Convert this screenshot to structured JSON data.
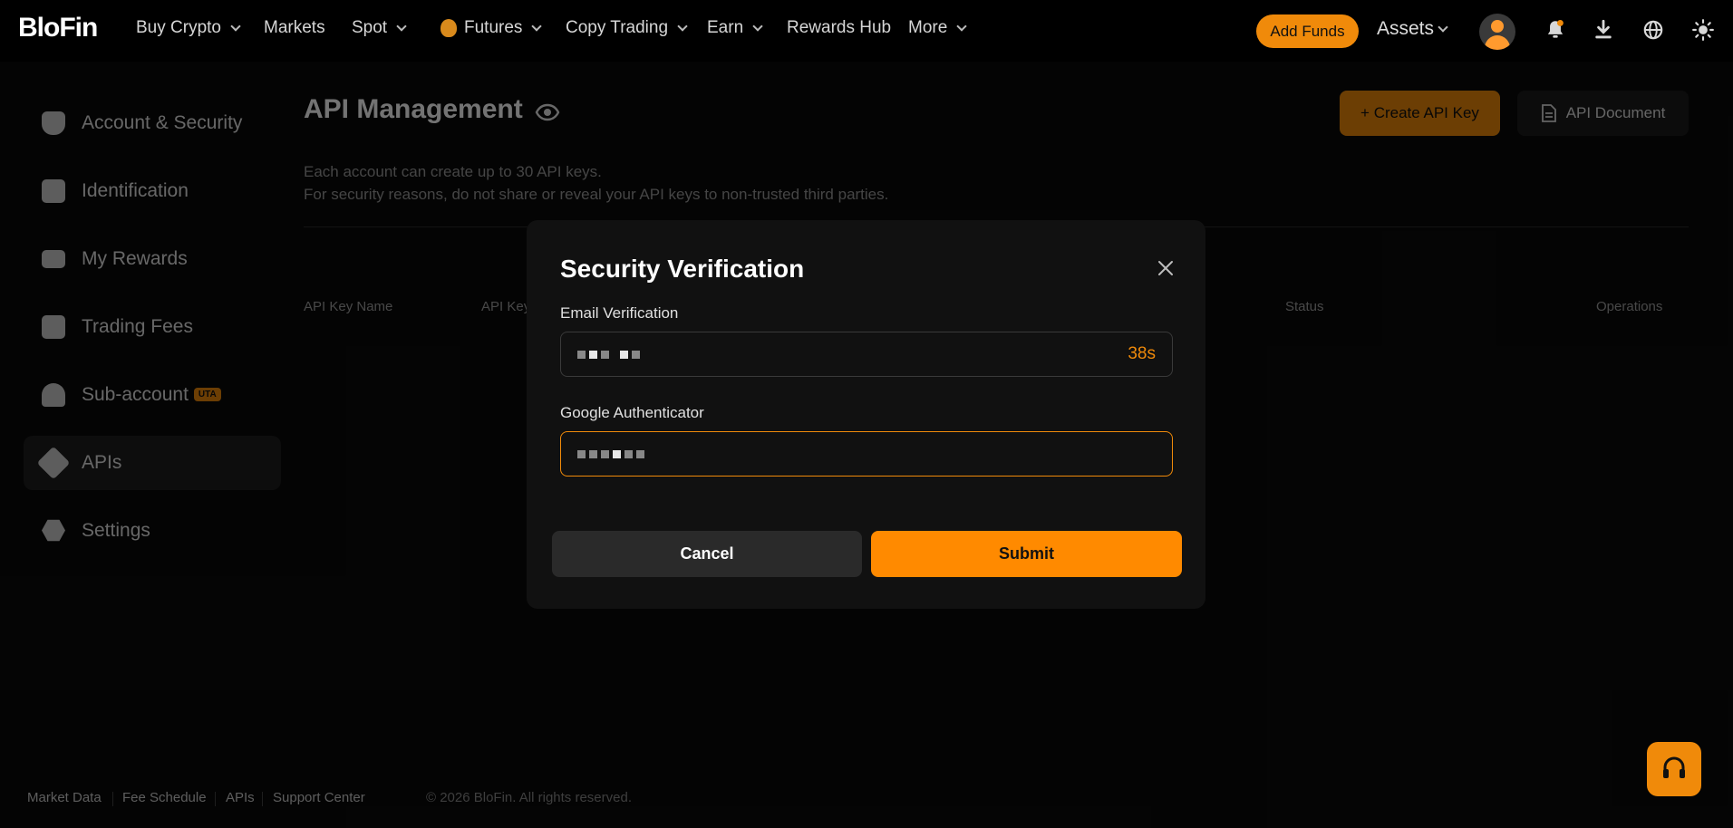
{
  "header": {
    "logo": "BloFin",
    "nav": [
      {
        "label": "Buy Crypto",
        "dropdown": true
      },
      {
        "label": "Markets",
        "dropdown": false
      },
      {
        "label": "Spot",
        "dropdown": true
      },
      {
        "label": "Futures",
        "dropdown": true
      },
      {
        "label": "Copy Trading",
        "dropdown": true
      },
      {
        "label": "Earn",
        "dropdown": true
      },
      {
        "label": "Rewards Hub",
        "dropdown": false
      },
      {
        "label": "More",
        "dropdown": true
      }
    ],
    "add_funds": "Add Funds",
    "assets": "Assets",
    "accent": "#f08a0a"
  },
  "sidebar": {
    "items": [
      {
        "label": "Account & Security",
        "icon": "shield-icon"
      },
      {
        "label": "Identification",
        "icon": "id-card-icon"
      },
      {
        "label": "My Rewards",
        "icon": "ticket-icon"
      },
      {
        "label": "Trading Fees",
        "icon": "fee-icon"
      },
      {
        "label": "Sub-account",
        "icon": "sub-account-icon",
        "badge": "UTA"
      },
      {
        "label": "APIs",
        "icon": "plug-icon",
        "active": true
      },
      {
        "label": "Settings",
        "icon": "settings-icon"
      }
    ]
  },
  "main": {
    "title": "API Management",
    "create_button": "+ Create API Key",
    "doc_button": "API Document",
    "desc_line1": "Each account can create up to 30 API keys.",
    "desc_line2": "For security reasons, do not share or reveal your API keys to non-trusted third parties.",
    "columns": [
      "API Key Name",
      "API Key",
      "Status",
      "Operations"
    ]
  },
  "modal": {
    "title": "Security Verification",
    "email_label": "Email Verification",
    "email_countdown": "38s",
    "google_label": "Google Authenticator",
    "cancel": "Cancel",
    "submit": "Submit"
  },
  "footer": {
    "links": [
      "Market Data",
      "Fee Schedule",
      "APIs",
      "Support Center"
    ],
    "copyright": "© 2026 BloFin. All rights reserved."
  }
}
